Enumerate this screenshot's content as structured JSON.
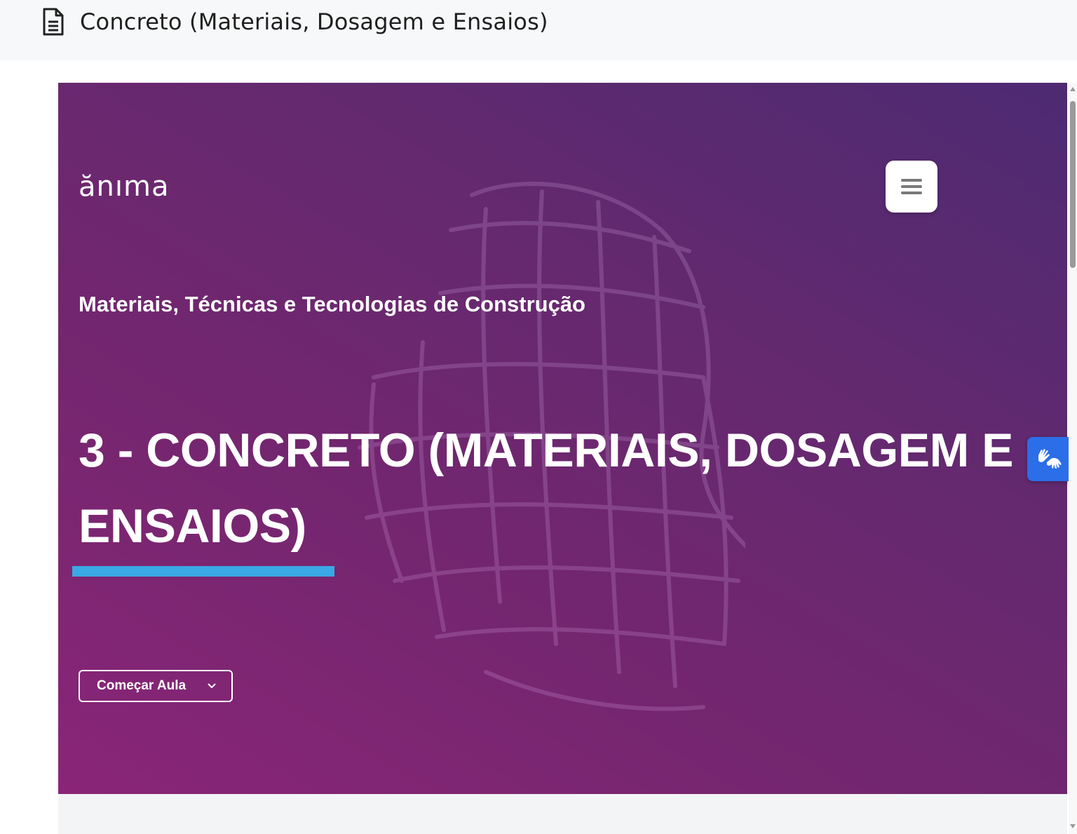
{
  "header": {
    "icon": "document-icon",
    "title": "Concreto (Materiais, Dosagem e Ensaios)"
  },
  "hero": {
    "logo": "ănıma",
    "menu_icon": "hamburger-icon",
    "course_name": "Materiais, Técnicas e Tecnologias de Construção",
    "lesson_title": "3 - CONCRETO (MATERIAIS, DOSAGEM E ENSAIOS)",
    "start_button": {
      "label": "Começar Aula",
      "icon": "chevron-down-icon"
    },
    "gradient_colors": [
      "#8a2577",
      "#64296f",
      "#4d2a72"
    ],
    "accent_color": "#3aa8e4"
  },
  "accessibility": {
    "libras_icon": "sign-language-hands-icon",
    "color": "#2b6ee8"
  }
}
